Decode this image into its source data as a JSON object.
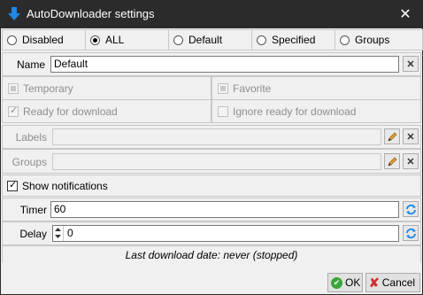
{
  "window": {
    "title": "AutoDownloader settings",
    "close_glyph": "✕",
    "icon": "download-arrow-icon"
  },
  "modes": [
    {
      "label": "Disabled",
      "selected": false
    },
    {
      "label": "ALL",
      "selected": true
    },
    {
      "label": "Default",
      "selected": false
    },
    {
      "label": "Specified",
      "selected": false
    },
    {
      "label": "Groups",
      "selected": false
    }
  ],
  "name": {
    "label": "Name",
    "value": "Default",
    "clear_glyph": "✕"
  },
  "options": {
    "temporary": "Temporary",
    "favorite": "Favorite",
    "ready_for_download": "Ready for download",
    "ignore_ready": "Ignore ready for download"
  },
  "labels": {
    "label": "Labels",
    "value": "",
    "clear_glyph": "✕"
  },
  "groups": {
    "label": "Groups",
    "value": "",
    "clear_glyph": "✕"
  },
  "show_notifications": {
    "label": "Show notifications",
    "checked": true,
    "check_glyph": "✓"
  },
  "timer": {
    "label": "Timer",
    "value": "60"
  },
  "delay": {
    "label": "Delay",
    "value": "0"
  },
  "status": "Last download date: never (stopped)",
  "buttons": {
    "ok": "OK",
    "cancel": "Cancel",
    "ok_glyph": "✔",
    "cancel_glyph": "✘"
  },
  "colors": {
    "accent_blue": "#1e88e5",
    "ok_green": "#3aa53a",
    "cancel_red": "#d32f2f",
    "titlebar": "#2b2b2b"
  }
}
